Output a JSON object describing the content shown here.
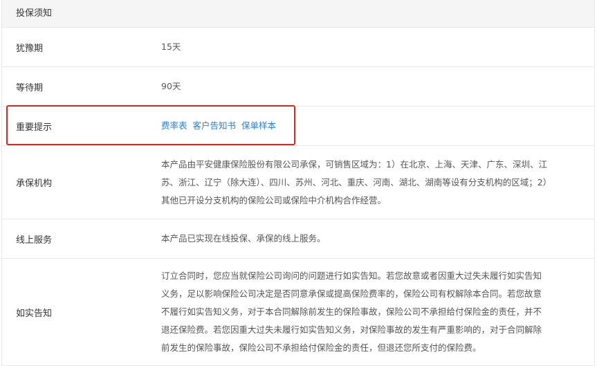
{
  "header": {
    "title": "投保须知"
  },
  "rows": [
    {
      "label": "犹豫期",
      "value": "15天"
    },
    {
      "label": "等待期",
      "value": "90天"
    },
    {
      "label": "重要提示",
      "links": [
        "费率表",
        "客户告知书",
        "保单样本"
      ]
    },
    {
      "label": "承保机构",
      "value": "本产品由平安健康保险股份有限公司承保，可销售区域为：1）在北京、上海、天津、广东、深圳、江苏、浙江、辽宁（除大连）、四川、苏州、河北、重庆、河南、湖北、湖南等设有分支机构的区域；2）其他已开设分支机构的保险公司或保险中介机构合作经营。"
    },
    {
      "label": "线上服务",
      "value": "本产品已实现在线投保、承保的线上服务。"
    },
    {
      "label": "如实告知",
      "value": "订立合同时，您应当就保险公司询问的问题进行如实告知。若您故意或者因重大过失未履行如实告知义务，足以影响保险公司决定是否同意承保或提高保险费率的，保险公司有权解除本合同。若您故意不履行如实告知义务，对于本合同解除前发生的保险事故，保险公司不承担给付保险金的责任，并不退还保险费。若您因重大过失未履行如实告知义务，对保险事故的发生有严重影响的，对于合同解除前发生的保险事故，保险公司不承担给付保险金的责任，但退还您所支付的保险费。"
    }
  ],
  "colors": {
    "link": "#2a7fcf",
    "highlight": "#e2231a",
    "header_bg": "#f5f5f5",
    "border": "#e8e8e8"
  }
}
